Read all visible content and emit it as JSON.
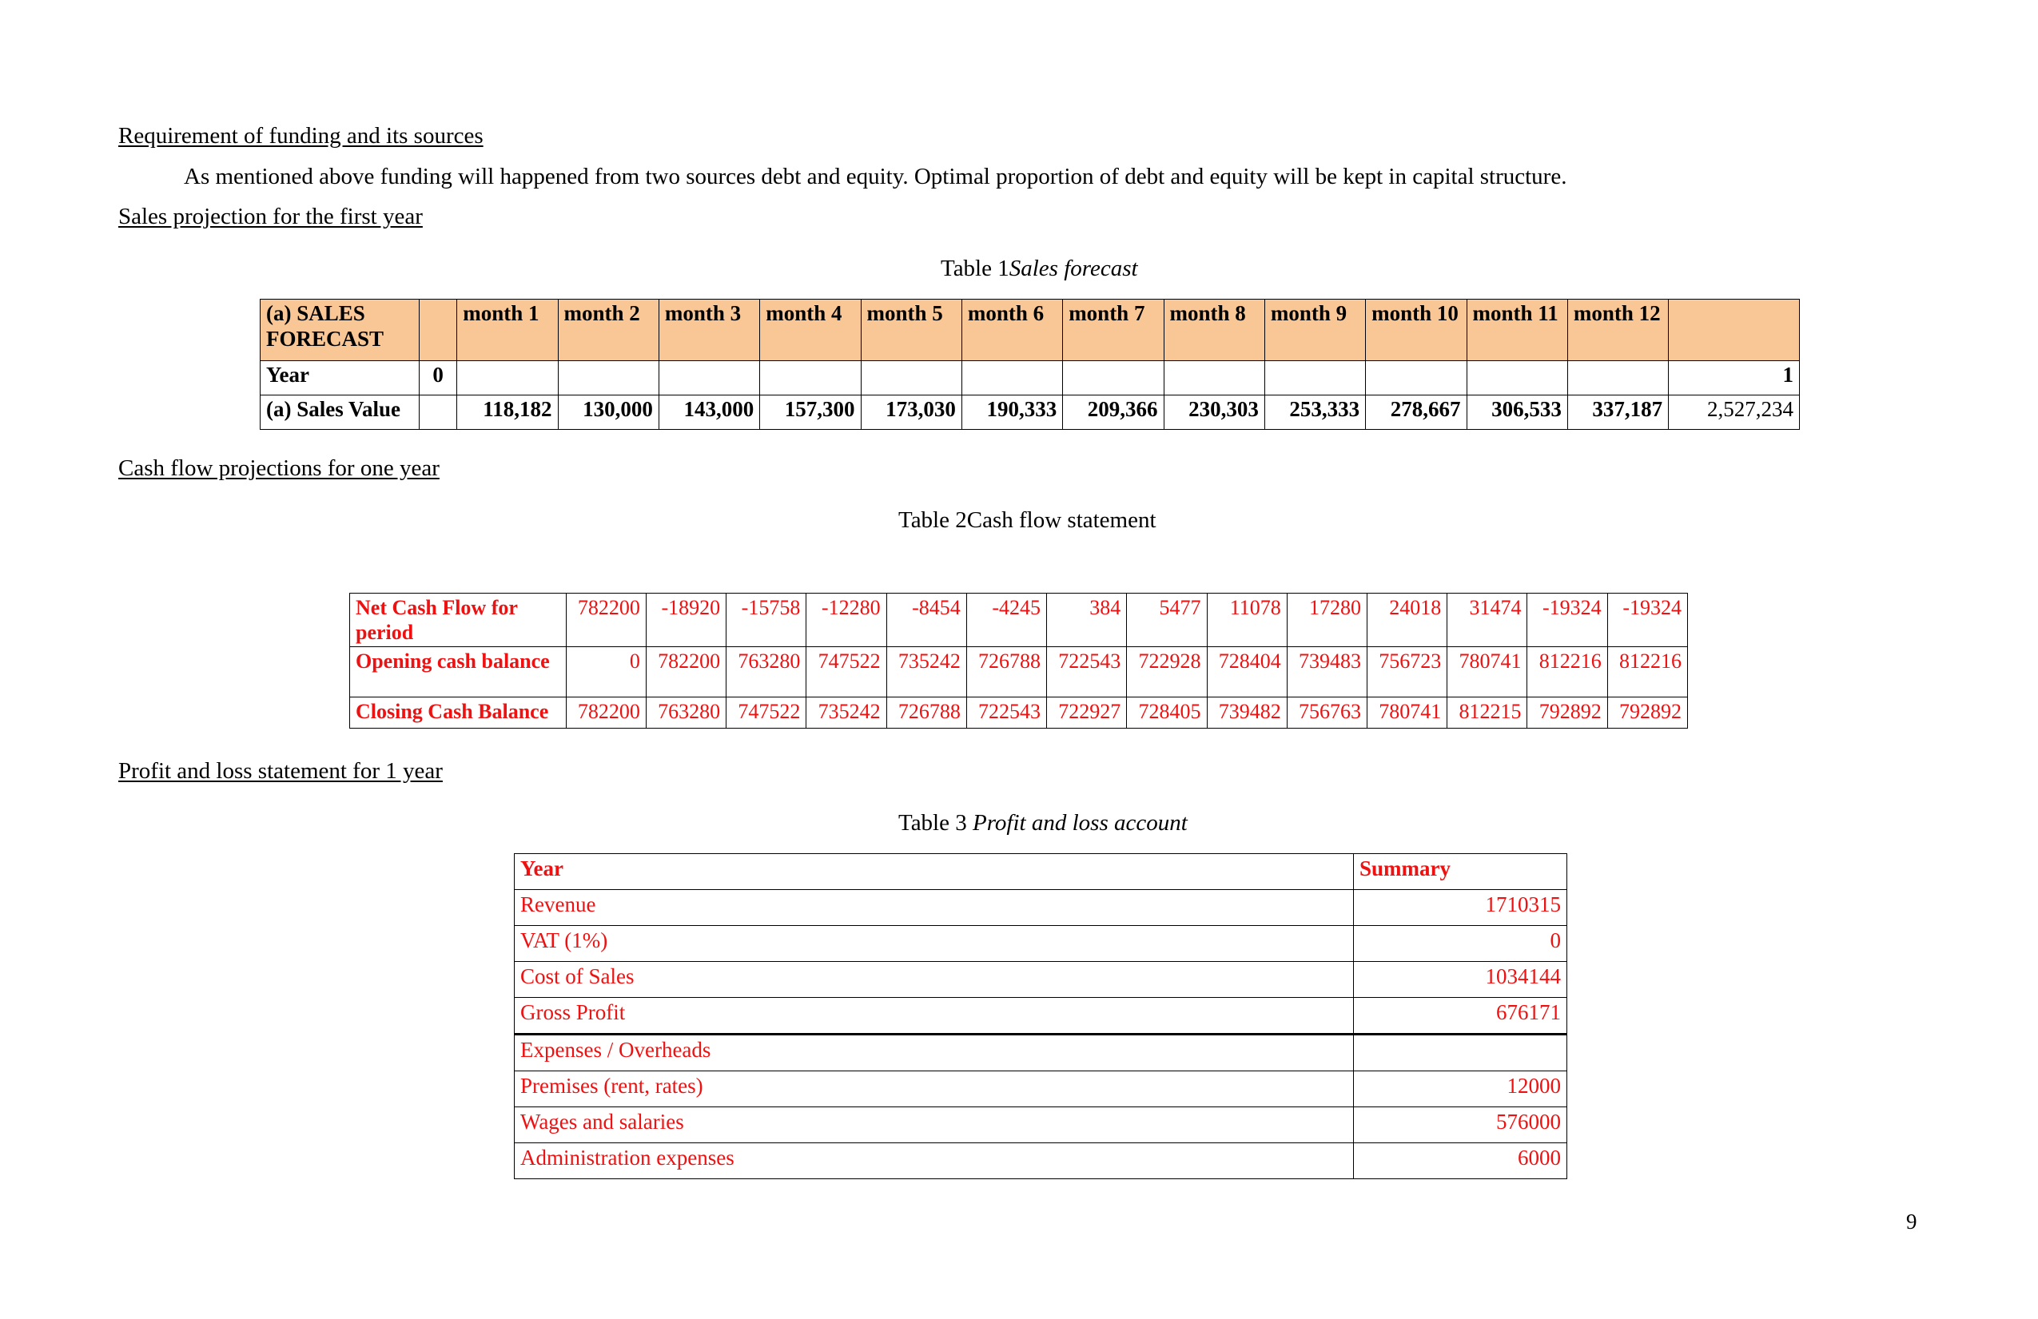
{
  "document": {
    "page_number": "9",
    "sections": [
      {
        "id": "funding",
        "heading": "Requirement of funding and its sources"
      },
      {
        "id": "sales",
        "heading": "Sales projection for the first year"
      },
      {
        "id": "cashflow",
        "heading": "Cash flow projections for one year"
      },
      {
        "id": "profitloss",
        "heading": "Profit and loss statement for 1 year"
      }
    ],
    "paragraphs": [
      {
        "id": "funding-body",
        "text": "As mentioned above funding will happened from two sources debt and equity. Optimal proportion of debt and equity will be kept in capital structure."
      }
    ],
    "captions": {
      "table1_prefix": "Table 1",
      "table1_title": "Sales forecast",
      "table2_prefix": "Table 2",
      "table2_title": "Cash flow statement",
      "table3_prefix": "Table 3 ",
      "table3_title": "Profit and loss account"
    }
  },
  "colors": {
    "header_fill": "#f9c795",
    "red_text": "#ee1111",
    "black_text": "#000000",
    "border": "#000000"
  },
  "table_sales_forecast": {
    "header": [
      "(a) SALES FORECAST",
      "",
      "month 1",
      "month 2",
      "month 3",
      "month 4",
      "month 5",
      "month 6",
      "month 7",
      "month 8",
      "month 9",
      "month 10",
      "month 11",
      "month 12",
      ""
    ],
    "header_label": "(a) SALES FORECAST",
    "header_label_line1": "(a) SALES",
    "header_label_line2": "FORECAST",
    "month_labels": [
      "month 1",
      "month 2",
      "month 3",
      "month 4",
      "month 5",
      "month 6",
      "month 7",
      "month 8",
      "month 9",
      "month 10",
      "month 11",
      "month 12"
    ],
    "rows": [
      {
        "label": "Year",
        "sub": "0",
        "values": [
          "",
          "",
          "",
          "",
          "",
          "",
          "",
          "",
          "",
          "",
          "",
          ""
        ],
        "total": "1"
      },
      {
        "label": "(a) Sales Value",
        "sub": "",
        "values": [
          "118,182",
          "130,000",
          "143,000",
          "157,300",
          "173,030",
          "190,333",
          "209,366",
          "230,303",
          "253,333",
          "278,667",
          "306,533",
          "337,187"
        ],
        "total": "2,527,234"
      }
    ]
  },
  "table_cash_flow": {
    "rows": [
      {
        "label": "Net Cash Flow for period",
        "values": [
          "782200",
          "-18920",
          "-15758",
          "-12280",
          "-8454",
          "-4245",
          "384",
          "5477",
          "11078",
          "17280",
          "24018",
          "31474",
          "-19324",
          "-19324"
        ]
      },
      {
        "label": "Opening cash balance",
        "values": [
          "0",
          "782200",
          "763280",
          "747522",
          "735242",
          "726788",
          "722543",
          "722928",
          "728404",
          "739483",
          "756723",
          "780741",
          "812216",
          "812216"
        ]
      },
      {
        "label": "Closing Cash Balance",
        "values": [
          "782200",
          "763280",
          "747522",
          "735242",
          "726788",
          "722543",
          "722927",
          "728405",
          "739482",
          "756763",
          "780741",
          "812215",
          "792892",
          "792892"
        ]
      }
    ]
  },
  "table_profit_loss": {
    "header": {
      "label": "Year",
      "value": "Summary"
    },
    "rows": [
      {
        "label": "Revenue",
        "value": "1710315",
        "thick_top": false
      },
      {
        "label": "VAT (1%)",
        "value": "0",
        "thick_top": false
      },
      {
        "label": "Cost of Sales",
        "value": "1034144",
        "thick_top": false
      },
      {
        "label": "Gross Profit",
        "value": "676171",
        "thick_top": false
      },
      {
        "label": "Expenses / Overheads",
        "value": "",
        "thick_top": true
      },
      {
        "label": "Premises (rent, rates)",
        "value": "12000",
        "thick_top": false
      },
      {
        "label": "Wages and salaries",
        "value": "576000",
        "thick_top": false
      },
      {
        "label": "Administration expenses",
        "value": "6000",
        "thick_top": false
      }
    ]
  }
}
